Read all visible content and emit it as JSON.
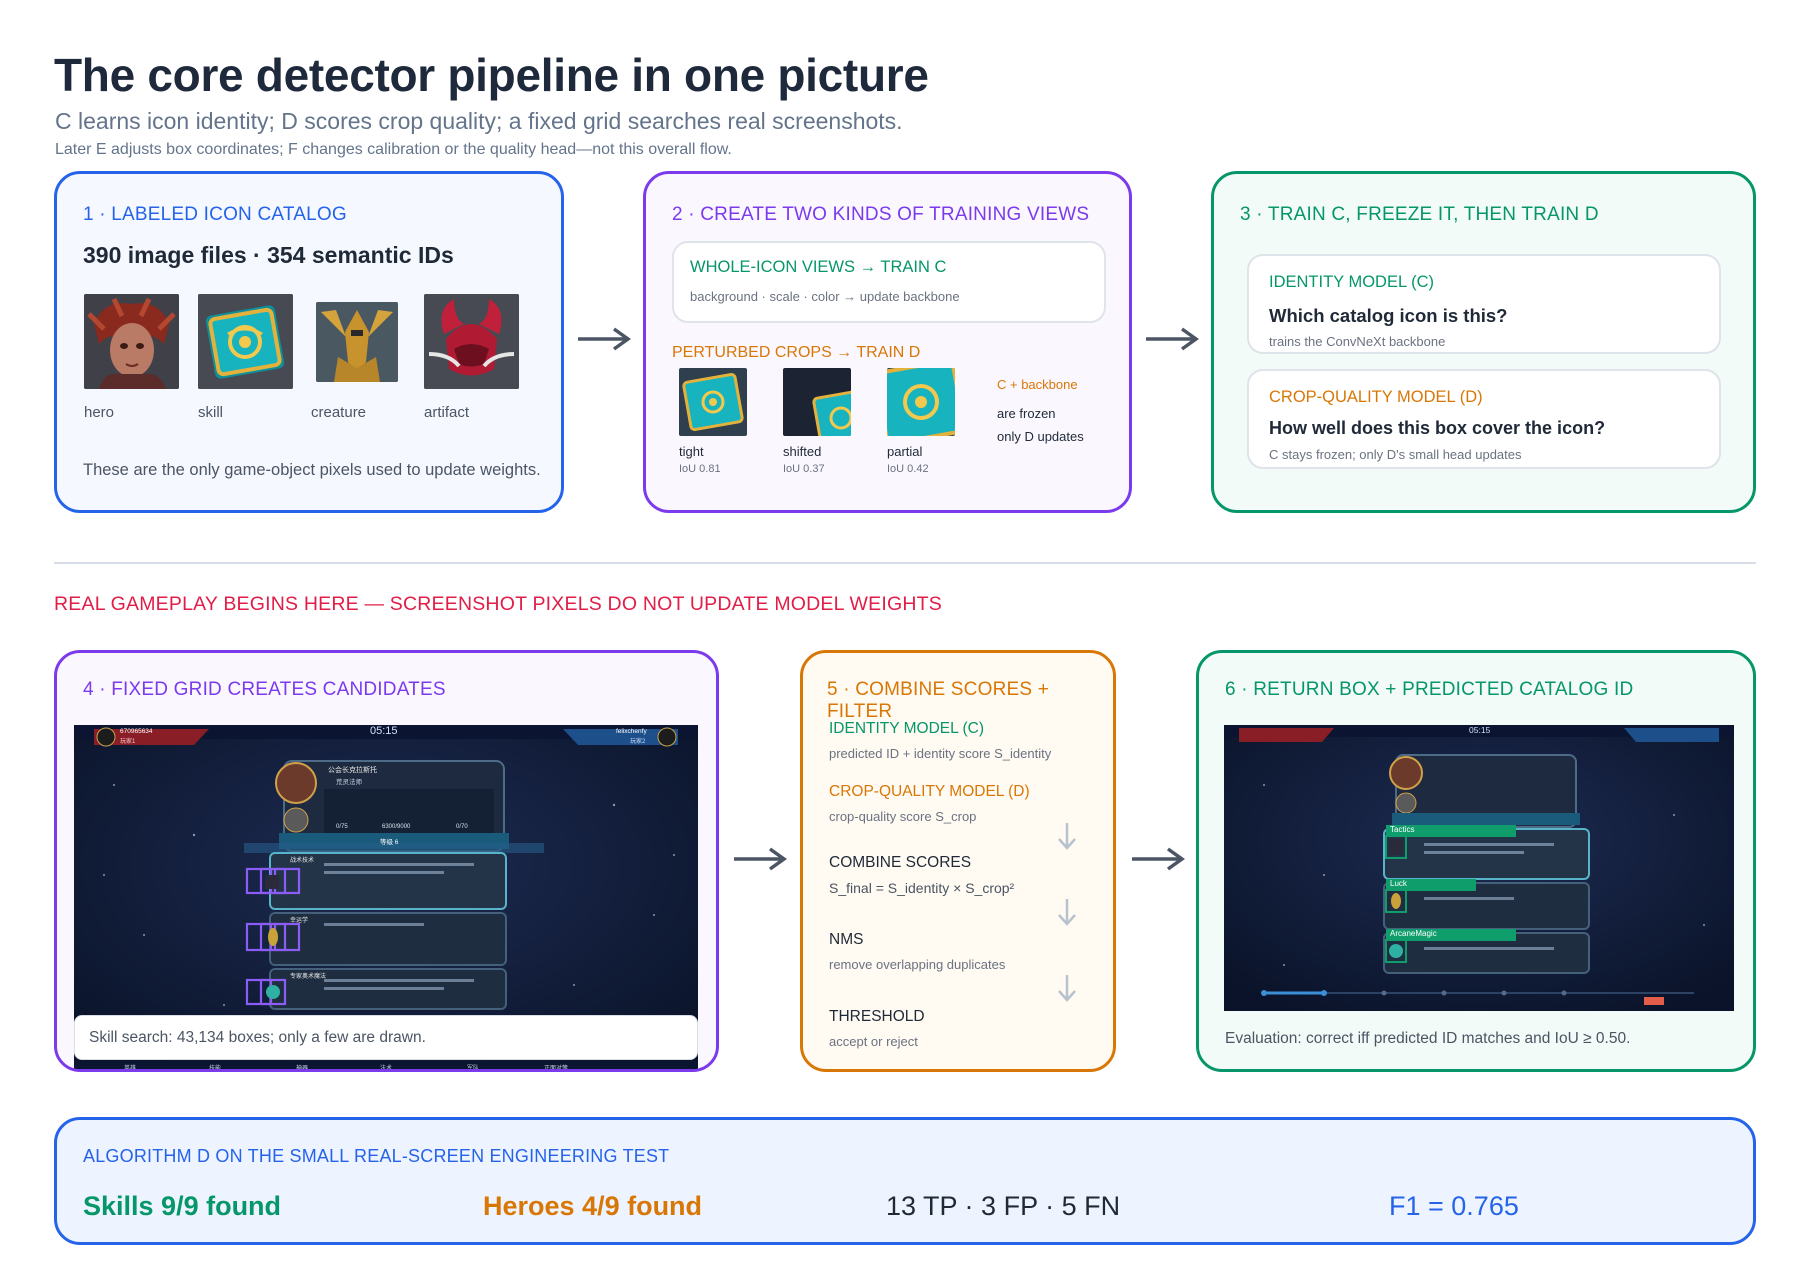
{
  "header": {
    "title": "The core detector pipeline in one picture",
    "subtitle": "C learns icon identity; D scores crop quality; a fixed grid searches real screenshots.",
    "note": "Later E adjusts box coordinates; F changes calibration or the quality head—not this overall flow."
  },
  "colors": {
    "blue": "#2563eb",
    "purple": "#7c3aed",
    "green": "#059669",
    "orange": "#d97706",
    "red": "#e11d48",
    "slate": "#4b5563"
  },
  "step1": {
    "heading": "1 · LABELED ICON CATALOG",
    "counts": "390 image files · 354 semantic IDs",
    "icons": [
      {
        "label": "hero",
        "icon": "hero-portrait-icon"
      },
      {
        "label": "skill",
        "icon": "skill-book-icon"
      },
      {
        "label": "creature",
        "icon": "creature-knight-icon"
      },
      {
        "label": "artifact",
        "icon": "artifact-helmet-icon"
      }
    ],
    "footer": "These are the only game-object pixels used to update weights."
  },
  "step2": {
    "heading": "2 · CREATE TWO KINDS OF TRAINING VIEWS",
    "whole_title": "WHOLE-ICON VIEWS → TRAIN C",
    "whole_desc": "background · scale · color → update backbone",
    "crops_title": "PERTURBED CROPS → TRAIN D",
    "crops": [
      {
        "label": "tight",
        "iou": "IoU 0.81"
      },
      {
        "label": "shifted",
        "iou": "IoU 0.37"
      },
      {
        "label": "partial",
        "iou": "IoU 0.42"
      }
    ],
    "frozen_line1": "C + backbone",
    "frozen_line2": "are frozen",
    "frozen_line3": "only D updates"
  },
  "step3": {
    "heading": "3 · TRAIN C, FREEZE IT, THEN TRAIN D",
    "c_title": "IDENTITY MODEL (C)",
    "c_question": "Which catalog icon is this?",
    "c_note": "trains the ConvNeXt backbone",
    "d_title": "CROP-QUALITY MODEL (D)",
    "d_question": "How well does this box cover the icon?",
    "d_note": "C stays frozen; only D's small head updates"
  },
  "banner": "REAL GAMEPLAY BEGINS HERE — SCREENSHOT PIXELS DO NOT UPDATE MODEL WEIGHTS",
  "step4": {
    "heading": "4 · FIXED GRID CREATES CANDIDATES",
    "caption": "Skill search: 43,134 boxes; only a few are drawn.",
    "shot": {
      "timer": "05:15",
      "player_left": "670965634",
      "player_left_sub": "玩家1",
      "player_right": "felixchenfy",
      "player_right_sub": "玩家2",
      "guild": "公会长克拉斯托",
      "guild_sub": "荒灵法师",
      "level": "等级 6",
      "stats": [
        "0/75",
        "6300/9000",
        "0/70"
      ],
      "rows": [
        "战术技术",
        "幸运学",
        "专家奥术魔法"
      ],
      "nav": [
        "英雄",
        "技能",
        "神器",
        "法术",
        "军队",
        "正面对策"
      ]
    }
  },
  "step5": {
    "heading": "5 · COMBINE SCORES + FILTER",
    "items": [
      {
        "title": "IDENTITY MODEL (C)",
        "desc": "predicted ID + identity score S_identity"
      },
      {
        "title": "CROP-QUALITY MODEL (D)",
        "desc": "crop-quality score S_crop"
      },
      {
        "title": "COMBINE SCORES",
        "desc": "S_final = S_identity × S_crop²"
      },
      {
        "title": "NMS",
        "desc": "remove overlapping duplicates"
      },
      {
        "title": "THRESHOLD",
        "desc": "accept or reject"
      }
    ]
  },
  "step6": {
    "heading": "6 · RETURN BOX + PREDICTED CATALOG ID",
    "labels": [
      "Tactics",
      "Luck",
      "ArcaneMagic"
    ],
    "caption": "Evaluation: correct iff predicted ID matches and IoU ≥ 0.50."
  },
  "results": {
    "heading": "ALGORITHM D ON THE SMALL REAL-SCREEN ENGINEERING TEST",
    "skills": "Skills 9/9 found",
    "heroes": "Heroes 4/9 found",
    "counts": "13 TP · 3 FP · 5 FN",
    "f1": "F1 = 0.765"
  }
}
